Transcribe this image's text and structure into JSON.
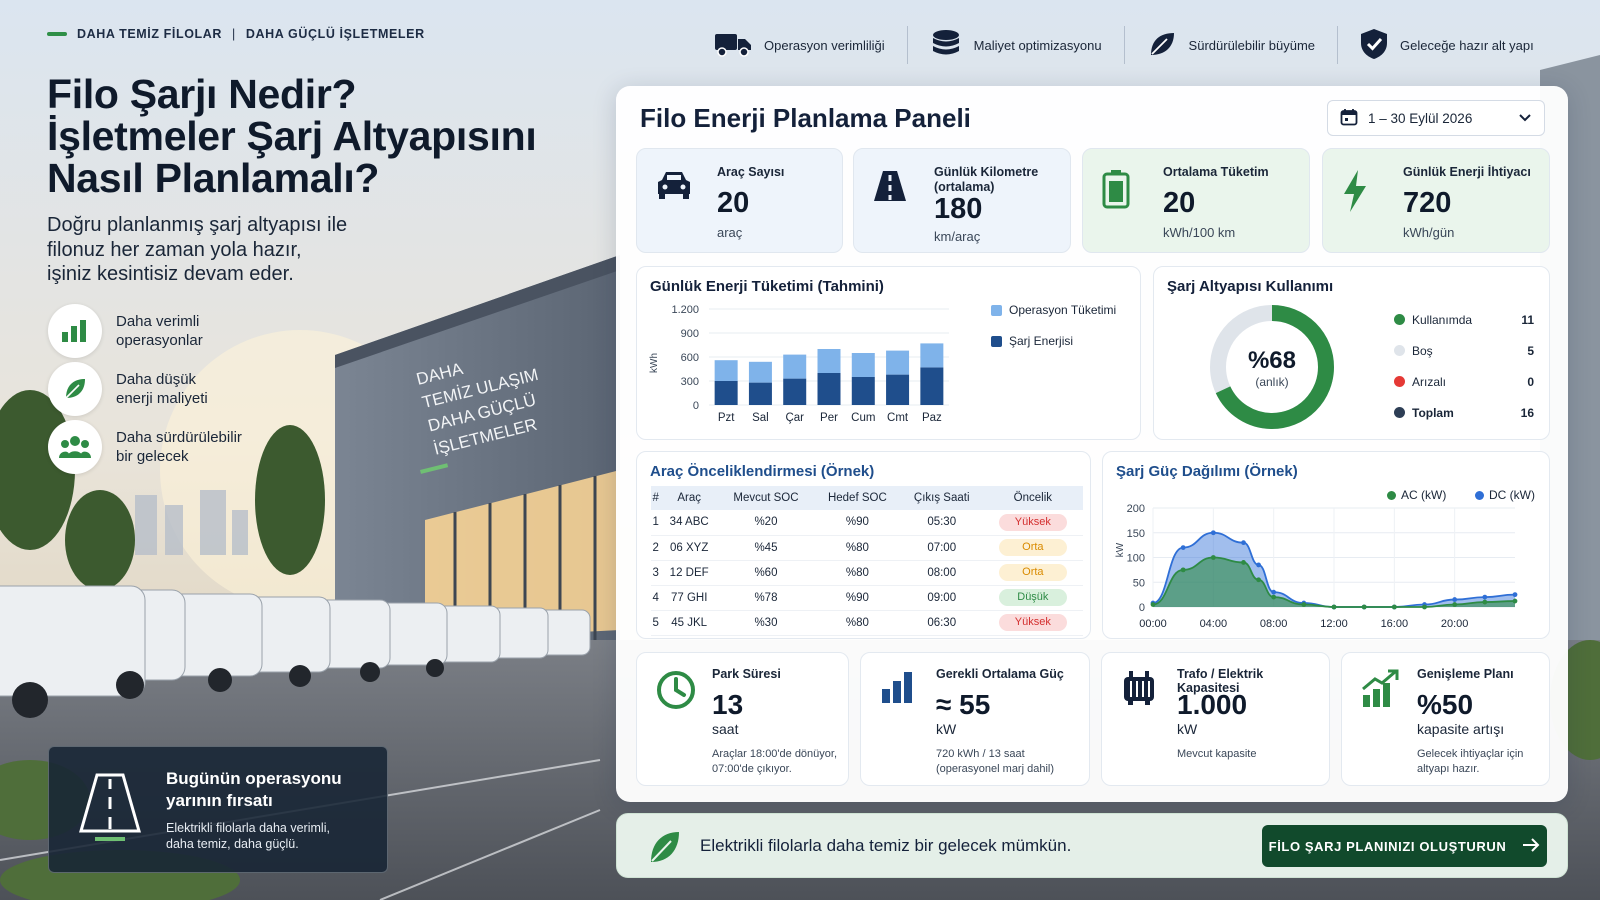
{
  "hero": {
    "tagline_left": "DAHA TEMİZ FİLOLAR",
    "tagline_sep": "|",
    "tagline_right": "DAHA GÜÇLÜ İŞLETMELER",
    "title_lines": [
      "Filo Şarjı Nedir?",
      "İşletmeler Şarj Altyapısını",
      "Nasıl Planlamalı?"
    ],
    "subtitle_lines": [
      "Doğru planlanmış şarj altyapısı ile",
      "filonuz her zaman yola hazır,",
      "işiniz kesintisiz devam eder."
    ],
    "features": [
      {
        "icon": "bar-chart-icon",
        "lines": [
          "Daha verimli",
          "operasyonlar"
        ]
      },
      {
        "icon": "leaf-icon",
        "lines": [
          "Daha düşük",
          "enerji maliyeti"
        ]
      },
      {
        "icon": "people-icon",
        "lines": [
          "Daha sürdürülebilir",
          "bir gelecek"
        ]
      }
    ],
    "building_sign_lines": [
      "DAHA",
      "TEMİZ ULAŞIM",
      "DAHA GÜÇLÜ",
      "İŞLETMELER"
    ],
    "promo": {
      "icon": "road-icon",
      "title_lines": [
        "Bugünün operasyonu",
        "yarının fırsatı"
      ],
      "text_lines": [
        "Elektrikli filolarla daha verimli,",
        "daha temiz, daha güçlü."
      ]
    }
  },
  "topbar": [
    {
      "icon": "truck-icon",
      "label": "Operasyon verimliliği"
    },
    {
      "icon": "coins-icon",
      "label": "Maliyet optimizasyonu"
    },
    {
      "icon": "leaf-icon",
      "label": "Sürdürülebilir büyüme"
    },
    {
      "icon": "shield-check-icon",
      "label": "Geleceğe hazır alt yapı"
    }
  ],
  "panel": {
    "title": "Filo Enerji Planlama Paneli",
    "date_range": "1 – 30 Eylül 2026",
    "kpis": [
      {
        "icon": "car-icon",
        "label_lines": [
          "Araç Sayısı"
        ],
        "value": "20",
        "unit": "araç"
      },
      {
        "icon": "road-icon",
        "label_lines": [
          "Günlük Kilometre",
          "(ortalama)"
        ],
        "value": "180",
        "unit": "km/araç"
      },
      {
        "icon": "battery-icon",
        "label_lines": [
          "Ortalama Tüketim"
        ],
        "value": "20",
        "unit": "kWh/100 km"
      },
      {
        "icon": "lightning-icon",
        "label_lines": [
          "Günlük Enerji İhtiyacı"
        ],
        "value": "720",
        "unit": "kWh/gün"
      }
    ],
    "usage": {
      "title": "Şarj Altyapısı Kullanımı",
      "center_value": "%68",
      "center_label": "(anlık)",
      "percent": 68,
      "legend": [
        {
          "label": "Kullanımda",
          "value": "11",
          "color": "#2e8b45"
        },
        {
          "label": "Boş",
          "value": "5",
          "color": "#dfe4ea"
        },
        {
          "label": "Arızalı",
          "value": "0",
          "color": "#e53935"
        },
        {
          "label": "Toplam",
          "value": "16",
          "color": "#2d3e55"
        }
      ]
    },
    "priority": {
      "title": "Araç Önceliklendirmesi (Örnek)",
      "headers": [
        "#",
        "Araç",
        "Mevcut SOC",
        "Hedef SOC",
        "Çıkış Saati",
        "Öncelik"
      ],
      "rows": [
        [
          "1",
          "34 ABC",
          "%20",
          "%90",
          "05:30",
          "Yüksek"
        ],
        [
          "2",
          "06 XYZ",
          "%45",
          "%80",
          "07:00",
          "Orta"
        ],
        [
          "3",
          "12 DEF",
          "%60",
          "%80",
          "08:00",
          "Orta"
        ],
        [
          "4",
          "77 GHI",
          "%78",
          "%90",
          "09:00",
          "Düşük"
        ],
        [
          "5",
          "45 JKL",
          "%30",
          "%80",
          "06:30",
          "Yüksek"
        ]
      ],
      "levels": [
        "hi",
        "mid",
        "mid",
        "lo",
        "hi"
      ]
    },
    "bottom": [
      {
        "icon": "clock-icon",
        "label": "Park Süresi",
        "value": "13",
        "unit": "saat",
        "note_lines": [
          "Araçlar 18:00'de dönüyor,",
          "07:00'de çıkıyor."
        ]
      },
      {
        "icon": "bar-chart-icon",
        "label": "Gerekli Ortalama Güç",
        "value": "≈ 55",
        "unit": "kW",
        "note_lines": [
          "720 kWh / 13 saat",
          "(operasyonel marj dahil)"
        ]
      },
      {
        "icon": "transformer-icon",
        "label": "Trafo / Elektrik Kapasitesi",
        "value": "1.000",
        "unit": "kW",
        "note_lines": [
          "Mevcut kapasite"
        ]
      },
      {
        "icon": "growth-chart-icon",
        "label": "Genişleme Planı",
        "value": "%50",
        "unit": "kapasite artışı",
        "note_lines": [
          "Gelecek ihtiyaçlar için",
          "altyapı hazır."
        ]
      }
    ]
  },
  "footer": {
    "icon": "leaf-icon",
    "text": "Elektrikli filolarla daha temiz bir gelecek mümkün.",
    "cta_label": "FİLO ŞARJ PLANINIZI OLUŞTURUN"
  },
  "colors": {
    "accent_green": "#2e8b45",
    "dark_green": "#114a2c",
    "navy": "#1f4e8c",
    "light_blue": "#7fb3ea"
  },
  "chart_data": [
    {
      "type": "bar",
      "title": "Günlük Enerji Tüketimi (Tahmini)",
      "ylabel": "kWh",
      "categories": [
        "Pzt",
        "Sal",
        "Çar",
        "Per",
        "Cum",
        "Cmt",
        "Paz"
      ],
      "yticks": [
        "0",
        "300",
        "600",
        "900",
        "1.200"
      ],
      "ylim": [
        0,
        1200
      ],
      "stacked": true,
      "series": [
        {
          "name": "Şarj Enerjisi",
          "color": "#1f4e8c",
          "values": [
            300,
            280,
            330,
            400,
            350,
            380,
            470
          ]
        },
        {
          "name": "Operasyon Tüketimi",
          "color": "#7fb3ea",
          "values": [
            260,
            260,
            300,
            300,
            300,
            300,
            300
          ]
        }
      ],
      "legend": "right"
    },
    {
      "type": "area",
      "title": "Şarj Güç Dağılımı (Örnek)",
      "ylabel": "kW",
      "ylim": [
        0,
        200
      ],
      "yticks": [
        "0",
        "50",
        "100",
        "150",
        "200"
      ],
      "xticks": [
        "00:00",
        "04:00",
        "08:00",
        "12:00",
        "16:00",
        "20:00"
      ],
      "x": [
        0,
        2,
        4,
        6,
        7,
        8,
        10,
        12,
        14,
        16,
        18,
        20,
        22,
        24
      ],
      "series": [
        {
          "name": "AC (kW)",
          "color": "#2e8b45",
          "values": [
            5,
            75,
            100,
            90,
            55,
            20,
            5,
            0,
            0,
            0,
            0,
            5,
            10,
            12
          ]
        },
        {
          "name": "DC (kW)",
          "color": "#2f6fd6",
          "values": [
            8,
            120,
            150,
            130,
            85,
            30,
            8,
            0,
            0,
            0,
            5,
            15,
            20,
            25
          ]
        }
      ],
      "legend": "top-right"
    }
  ]
}
